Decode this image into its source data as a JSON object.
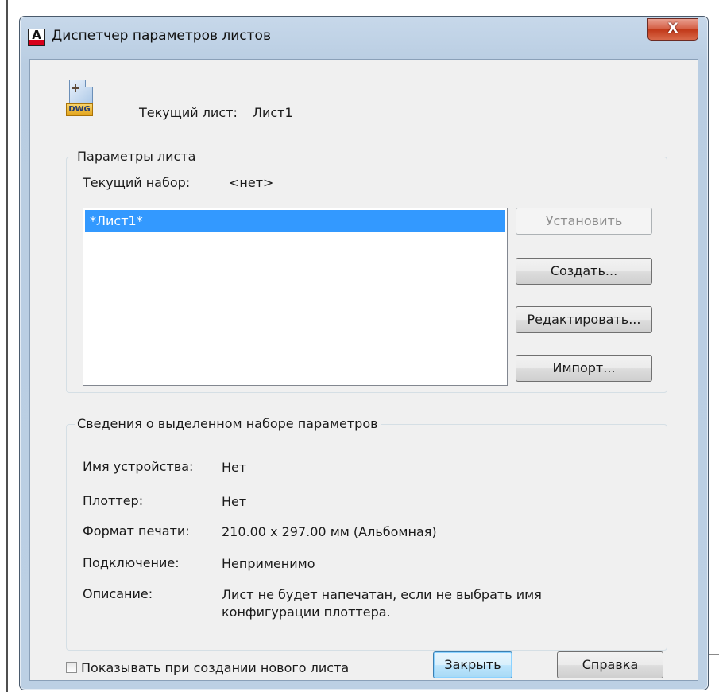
{
  "window": {
    "title": "Диспетчер параметров листов",
    "close_label": "X"
  },
  "header": {
    "current_sheet_label": "Текущий лист:",
    "current_sheet_value": "Лист1",
    "file_icon_label": "DWG"
  },
  "sheet_params": {
    "group_title": "Параметры листа",
    "current_set_label": "Текущий набор:",
    "current_set_value": "<нет>",
    "list_items": [
      "*Лист1*"
    ],
    "buttons": {
      "install": "Установить",
      "create": "Создать...",
      "edit": "Редактировать...",
      "import": "Импорт..."
    }
  },
  "details": {
    "group_title": "Сведения о выделенном наборе параметров",
    "rows": [
      {
        "label": "Имя устройства:",
        "value": "Нет"
      },
      {
        "label": "Плоттер:",
        "value": "Нет"
      },
      {
        "label": "Формат печати:",
        "value": "210.00 x 297.00 мм (Альбомная)"
      },
      {
        "label": "Подключение:",
        "value": "Неприменимо"
      },
      {
        "label": "Описание:",
        "value": "Лист не будет напечатан, если не выбрать имя конфигурации плоттера."
      }
    ]
  },
  "footer": {
    "checkbox_label": "Показывать при создании нового листа",
    "checkbox_checked": false,
    "close_button": "Закрыть",
    "help_button": "Справка"
  },
  "colors": {
    "selection": "#3399ff",
    "close_button_red": "#c13818"
  }
}
